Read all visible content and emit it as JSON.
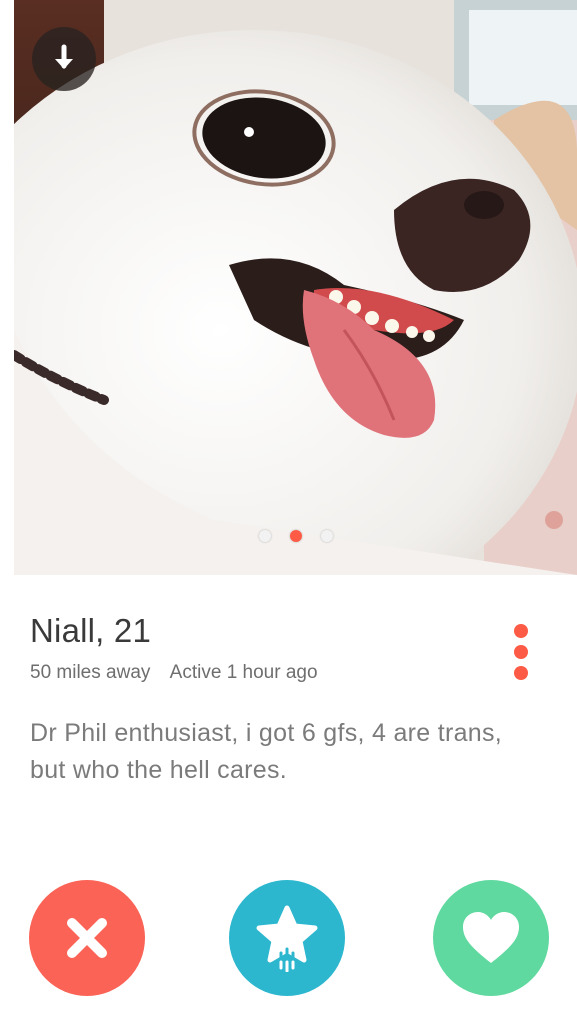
{
  "photo": {
    "subject_icon": "dog-photo",
    "back_icon": "arrow-down-icon",
    "pagination": {
      "total": 3,
      "active_index": 1
    }
  },
  "profile": {
    "name_age": "Niall, 21",
    "distance": "50 miles away",
    "active": "Active 1 hour ago",
    "bio": "Dr Phil enthusiast, i got 6 gfs, 4 are trans, but who the hell cares.",
    "more_icon": "vertical-dots-icon"
  },
  "actions": {
    "nope_icon": "close-x-icon",
    "superlike_icon": "star-icon",
    "like_icon": "heart-icon"
  },
  "colors": {
    "accent": "#fd5b45",
    "nope": "#fb6356",
    "superlike": "#2cb7cf",
    "like": "#5fd99f",
    "name_text": "#3a3a3a",
    "meta_text": "#6e6e6e",
    "bio_text": "#7b7b7b"
  }
}
